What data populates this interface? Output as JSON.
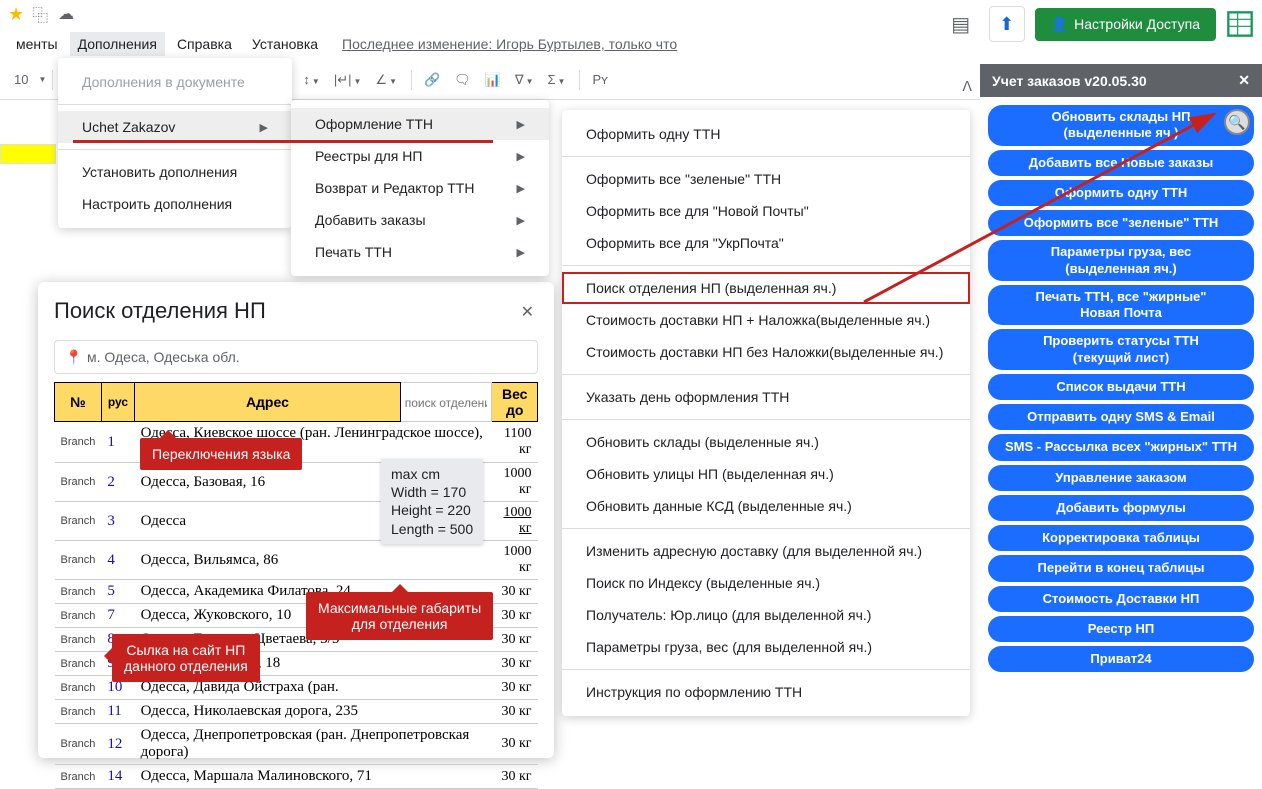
{
  "topbar": {
    "star": "★",
    "folder": "⧉",
    "cloud": "☁"
  },
  "top_right": {
    "doc": "▤",
    "upload": "⬆",
    "share_person": "👤",
    "share_label": "Настройки Доступа"
  },
  "menubar": {
    "items": [
      "менты",
      "Дополнения",
      "Справка",
      "Установка"
    ],
    "last_edit": "Последнее изменение: Игорь Буртылев, только что"
  },
  "toolbar": {
    "font_size": "10",
    "py": "Pʏ"
  },
  "menu1": {
    "doc_addons": "Дополнения в документе",
    "uchet": "Uchet Zakazov",
    "install": "Установить дополнения",
    "configure": "Настроить дополнения"
  },
  "menu2": {
    "items": [
      "Оформление ТТН",
      "Реестры для НП",
      "Возврат и Редактор ТТН",
      "Добавить заказы",
      "Печать ТТН"
    ]
  },
  "menu3": {
    "items": [
      "Оформить одну ТТН",
      "-",
      "Оформить все \"зеленые\" ТТН",
      "Оформить все для \"Новой Почты\"",
      "Оформить все для \"УкрПочта\"",
      "-",
      "Поиск отделения НП (выделенная яч.)",
      "Стоимость доставки НП + Наложка(выделенные яч.)",
      "Стоимость доставки НП без Наложки(выделенные яч.)",
      "-",
      "Указать день оформления ТТН",
      "-",
      "Обновить склады (выделенные яч.)",
      "Обновить улицы НП (выделенная яч.)",
      "Обновить данные КСД (выделенные яч.)",
      "-",
      "Изменить адресную доставку (для выделенной яч.)",
      "Поиск по Индексу (выделенные яч.)",
      "Получатель: Юр.лицо (для выделенной яч.)",
      "Параметры груза, вес (для выделенной яч.)",
      "-",
      "Инструкция по оформлению ТТН"
    ],
    "highlighted_index": 6
  },
  "dialog": {
    "title": "Поиск отделения НП",
    "city": "м. Одеса, Одеська обл.",
    "headers": {
      "num": "№",
      "lang": "рус",
      "addr": "Адрес",
      "filter_placeholder": "поиск отделения",
      "weight": "Вес до"
    },
    "rows": [
      {
        "branch": "Branch",
        "num": "1",
        "addr": "Одесса, Киевское шоссе (ран. Ленинградское шоссе), 27",
        "weight": "1100 кг"
      },
      {
        "branch": "Branch",
        "num": "2",
        "addr": "Одесса, Базовая, 16",
        "weight": "1000 кг"
      },
      {
        "branch": "Branch",
        "num": "3",
        "addr": "Одесса",
        "weight": "1000 кг",
        "u": true
      },
      {
        "branch": "Branch",
        "num": "4",
        "addr": "Одесса, Вильямса, 86",
        "weight": "1000 кг"
      },
      {
        "branch": "Branch",
        "num": "5",
        "addr": "Одесса, Академика Филатова, 24",
        "weight": "30 кг"
      },
      {
        "branch": "Branch",
        "num": "7",
        "addr": "Одесса, Жуковского, 10",
        "weight": "30 кг"
      },
      {
        "branch": "Branch",
        "num": "8",
        "addr": "Одесса, Генерала Цветаева, 3/5",
        "weight": "30 кг"
      },
      {
        "branch": "Branch",
        "num": "9",
        "addr": "Одесса, Сегедская, 18",
        "weight": "30 кг"
      },
      {
        "branch": "Branch",
        "num": "10",
        "addr": "Одесса, Давида Ойстраха (ран.",
        "weight": "30 кг"
      },
      {
        "branch": "Branch",
        "num": "11",
        "addr": "Одесса, Николаевская дорога, 235",
        "weight": "30 кг"
      },
      {
        "branch": "Branch",
        "num": "12",
        "addr": "Одесса, Днепропетровская (ран. Днепропетровская дорога)",
        "weight": "30 кг"
      },
      {
        "branch": "Branch",
        "num": "14",
        "addr": "Одесса, Маршала Малиновского, 71",
        "weight": "30 кг"
      }
    ]
  },
  "tooltip": {
    "l1": "max cm",
    "l2": "Width = 170",
    "l3": "Height = 220",
    "l4": "Length = 500"
  },
  "callouts": {
    "c1": "Переключения языка",
    "c2": "Максимальные габариты\nдля отделения",
    "c3": "Сылка на сайт НП\nданного отделения"
  },
  "sidebar": {
    "title": "Учет заказов v20.05.30",
    "buttons": [
      "Обновить склады НП\n(выделенные яч.)",
      "Добавить все Новые заказы",
      "Оформить одну ТТН",
      "Оформить все \"зеленые\" ТТН",
      "Параметры груза, вес\n(выделенная яч.)",
      "Печать ТТН, все \"жирные\"\nНовая Почта",
      "Проверить статусы ТТН\n(текущий лист)",
      "Список выдачи ТТН",
      "Отправить одну SMS & Email",
      "SMS - Рассылка всех \"жирных\" ТТН",
      "Управление заказом",
      "Добавить формулы",
      "Корректировка таблицы",
      "Перейти в конец таблицы",
      "Стоимость Доставки НП",
      "Реестр НП",
      "Приват24"
    ]
  }
}
